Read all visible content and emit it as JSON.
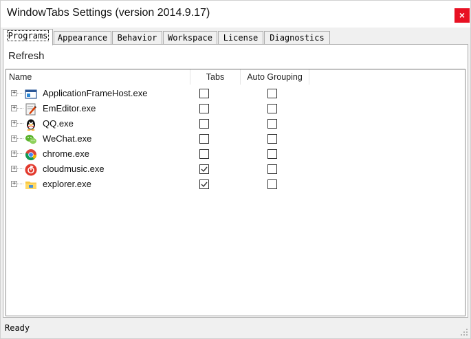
{
  "window": {
    "title": "WindowTabs Settings (version 2014.9.17)",
    "close_label": "×"
  },
  "tabs": [
    {
      "label": "Programs",
      "active": true
    },
    {
      "label": "Appearance",
      "active": false
    },
    {
      "label": "Behavior",
      "active": false
    },
    {
      "label": "Workspace",
      "active": false
    },
    {
      "label": "License",
      "active": false
    },
    {
      "label": "Diagnostics",
      "active": false
    }
  ],
  "toolbar": {
    "refresh_label": "Refresh"
  },
  "list": {
    "columns": {
      "name": "Name",
      "tabs": "Tabs",
      "auto_grouping": "Auto Grouping"
    },
    "rows": [
      {
        "name": "ApplicationFrameHost.exe",
        "icon": "application-frame-host-icon",
        "tabs": false,
        "auto_grouping": false
      },
      {
        "name": "EmEditor.exe",
        "icon": "emeditor-icon",
        "tabs": false,
        "auto_grouping": false
      },
      {
        "name": "QQ.exe",
        "icon": "qq-penguin-icon",
        "tabs": false,
        "auto_grouping": false
      },
      {
        "name": "WeChat.exe",
        "icon": "wechat-icon",
        "tabs": false,
        "auto_grouping": false
      },
      {
        "name": "chrome.exe",
        "icon": "chrome-icon",
        "tabs": false,
        "auto_grouping": false
      },
      {
        "name": "cloudmusic.exe",
        "icon": "cloudmusic-icon",
        "tabs": true,
        "auto_grouping": false
      },
      {
        "name": "explorer.exe",
        "icon": "explorer-folder-icon",
        "tabs": true,
        "auto_grouping": false
      }
    ]
  },
  "status": {
    "text": "Ready"
  },
  "colors": {
    "close_button": "#e81123",
    "panel_background": "#f0f0f0",
    "border": "#adadad"
  }
}
